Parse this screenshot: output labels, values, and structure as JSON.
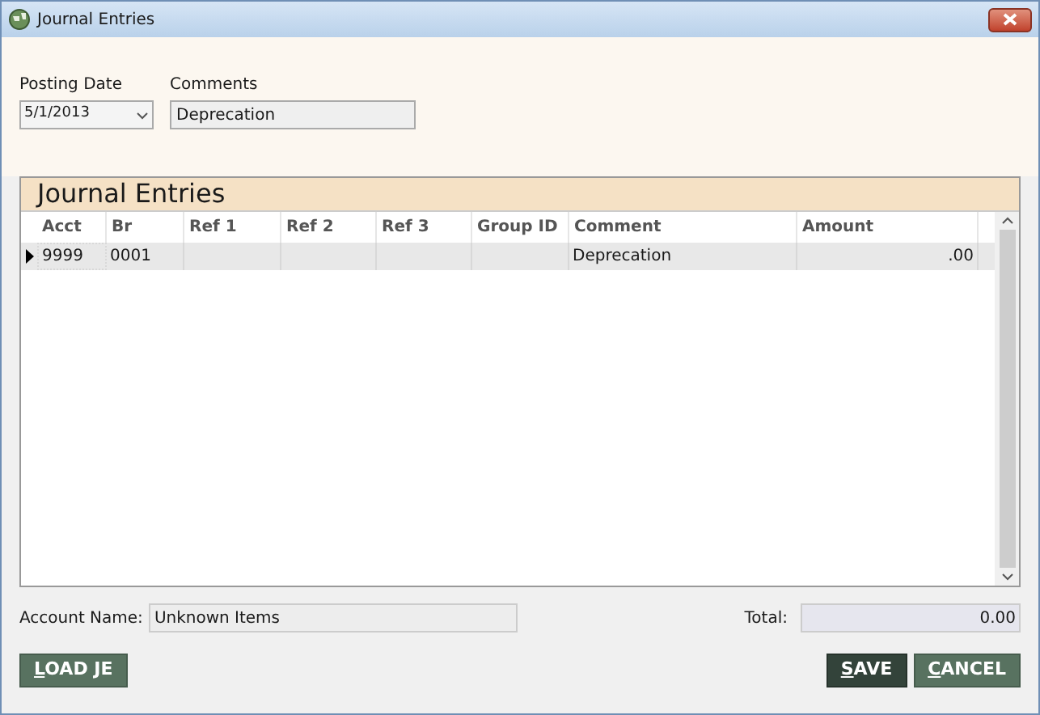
{
  "window": {
    "title": "Journal Entries"
  },
  "posting_date": {
    "label": "Posting Date",
    "value": "5/1/2013"
  },
  "comments": {
    "label": "Comments",
    "value": "Deprecation"
  },
  "grid": {
    "title": "Journal Entries",
    "columns": [
      "Acct",
      "Br",
      "Ref 1",
      "Ref 2",
      "Ref 3",
      "Group ID",
      "Comment",
      "Amount"
    ],
    "rows": [
      {
        "selected": true,
        "cells": [
          "9999",
          "0001",
          "",
          "",
          "",
          "",
          "Deprecation",
          ".00"
        ]
      }
    ]
  },
  "account_name": {
    "label": "Account Name:",
    "value": "Unknown Items"
  },
  "total": {
    "label": "Total:",
    "value": "0.00"
  },
  "buttons": [
    {
      "label": "LOAD JE",
      "primary": false
    },
    {
      "label": "SAVE",
      "primary": true
    },
    {
      "label": "CANCEL",
      "primary": false
    }
  ]
}
